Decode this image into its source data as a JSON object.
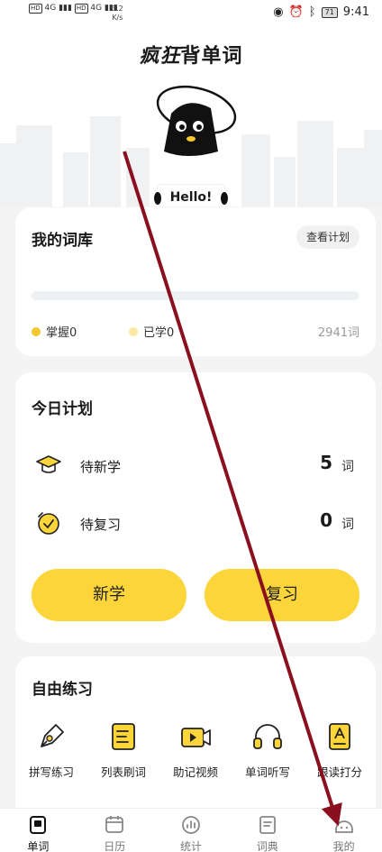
{
  "status_bar": {
    "hd1": "HD",
    "hd2": "HD",
    "sig1": "4G",
    "sig2": "4G",
    "speed": "3.2",
    "speed_unit": "K/s",
    "battery": "71",
    "time": "9:41"
  },
  "header": {
    "logo_bold": "疯狂",
    "logo_rest": "背单词",
    "hello": "Hello!"
  },
  "wordbank": {
    "title": "我的词库",
    "plan_button": "查看计划",
    "progress": 0,
    "mastered_label": "掌握0",
    "learned_label": "已学0",
    "total_label": "2941词",
    "colors": {
      "mastered": "#f8c72d",
      "learned": "#fce7a3"
    }
  },
  "today_plan": {
    "title": "今日计划",
    "rows": [
      {
        "label": "待新学",
        "count": "5",
        "unit": "词",
        "icon": "graduation-cap-icon"
      },
      {
        "label": "待复习",
        "count": "0",
        "unit": "词",
        "icon": "review-clock-icon"
      }
    ],
    "new_button": "新学",
    "review_button": "复习"
  },
  "practice": {
    "title": "自由练习",
    "tools": [
      {
        "label": "拼写练习",
        "icon": "pen-icon"
      },
      {
        "label": "列表刷词",
        "icon": "list-icon"
      },
      {
        "label": "助记视频",
        "icon": "video-icon"
      },
      {
        "label": "单词听写",
        "icon": "headphones-icon"
      },
      {
        "label": "跟读打分",
        "icon": "read-score-icon"
      }
    ]
  },
  "tabbar": {
    "items": [
      {
        "label": "单词",
        "icon": "word-book-icon",
        "active": true
      },
      {
        "label": "日历",
        "icon": "calendar-icon",
        "active": false
      },
      {
        "label": "统计",
        "icon": "stats-icon",
        "active": false
      },
      {
        "label": "词典",
        "icon": "dictionary-icon",
        "active": false
      },
      {
        "label": "我的",
        "icon": "profile-icon",
        "active": false
      }
    ]
  },
  "colors": {
    "accent": "#fbd53a",
    "arrow": "#8a1020"
  }
}
